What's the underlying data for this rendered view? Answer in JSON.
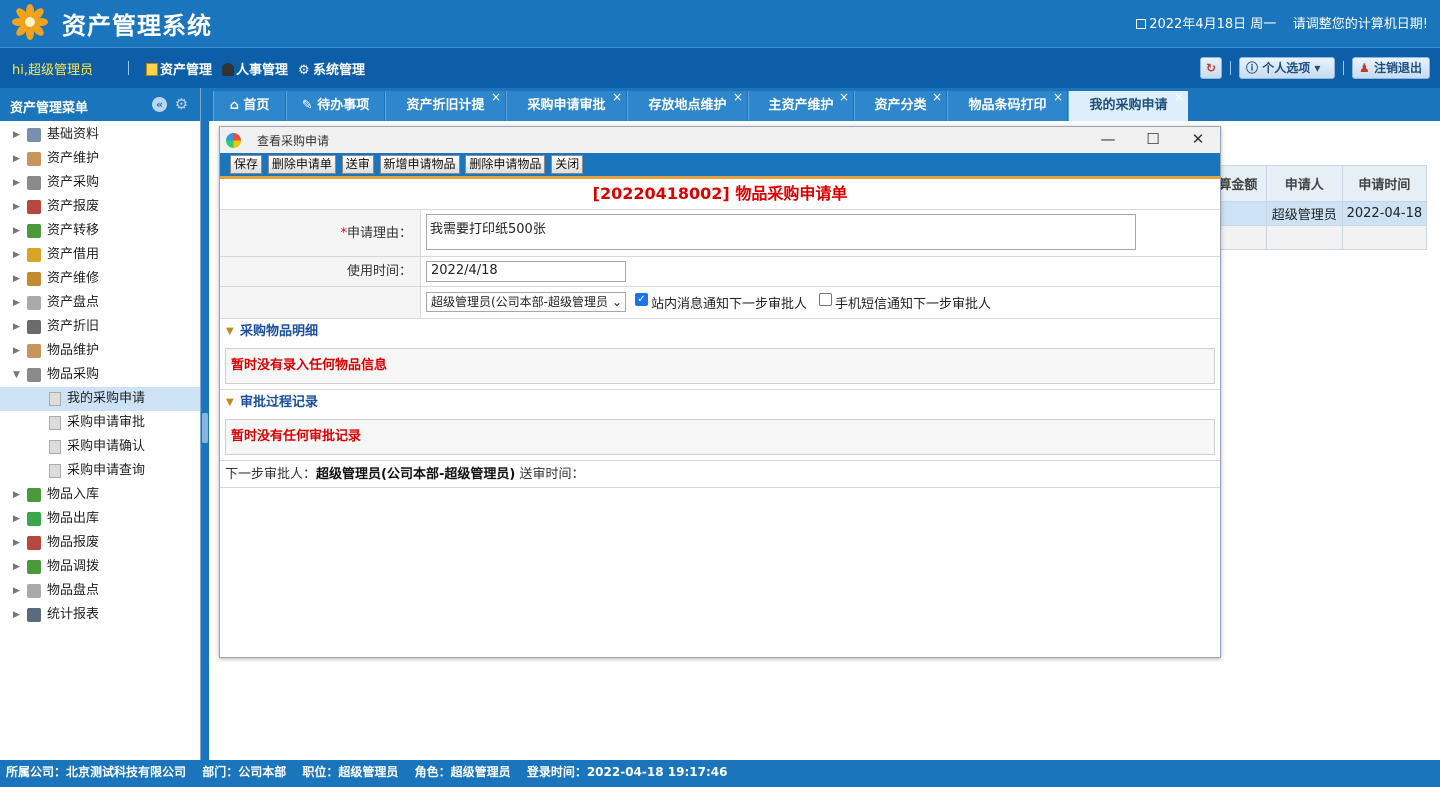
{
  "app": {
    "title": "资产管理系统",
    "date": "2022年4月18日 周一",
    "date_notice": "请调整您的计算机日期!"
  },
  "menubar": {
    "greeting": "hi,超级管理员",
    "menus": [
      "资产管理",
      "人事管理",
      "系统管理"
    ],
    "refresh_icon": "refresh-icon",
    "personal_label": "个人选项",
    "logout_label": "注销退出"
  },
  "sidebar": {
    "title": "资产管理菜单",
    "items": [
      {
        "label": "基础资料",
        "icon": "folder-icon",
        "color": "#7a8fb0"
      },
      {
        "label": "资产维护",
        "icon": "box-icon",
        "color": "#c9955a"
      },
      {
        "label": "资产采购",
        "icon": "cart-icon",
        "color": "#8a8a8a"
      },
      {
        "label": "资产报废",
        "icon": "trash-icon",
        "color": "#b8473f"
      },
      {
        "label": "资产转移",
        "icon": "transfer-icon",
        "color": "#4a9a3c"
      },
      {
        "label": "资产借用",
        "icon": "borrow-icon",
        "color": "#d9a326"
      },
      {
        "label": "资产维修",
        "icon": "repair-icon",
        "color": "#c48a2e"
      },
      {
        "label": "资产盘点",
        "icon": "calendar-icon",
        "color": "#aaaaaa"
      },
      {
        "label": "资产折旧",
        "icon": "calculator-icon",
        "color": "#6b6b6b"
      },
      {
        "label": "物品维护",
        "icon": "box-icon",
        "color": "#c9955a"
      },
      {
        "label": "物品采购",
        "icon": "cart-icon",
        "color": "#8a8a8a"
      }
    ],
    "children": [
      "我的采购申请",
      "采购申请审批",
      "采购申请确认",
      "采购申请查询"
    ],
    "items_after": [
      {
        "label": "物品入库",
        "icon": "inbound-icon",
        "color": "#4a9a3c"
      },
      {
        "label": "物品出库",
        "icon": "outbound-icon",
        "color": "#3aa84a"
      },
      {
        "label": "物品报废",
        "icon": "trash-icon",
        "color": "#b8473f"
      },
      {
        "label": "物品调拨",
        "icon": "transfer-icon",
        "color": "#4a9a3c"
      },
      {
        "label": "物品盘点",
        "icon": "calendar-icon",
        "color": "#aaaaaa"
      },
      {
        "label": "统计报表",
        "icon": "chart-icon",
        "color": "#5a6a80"
      }
    ]
  },
  "tabs": [
    {
      "label": "首页",
      "closable": false
    },
    {
      "label": "待办事项",
      "closable": false
    },
    {
      "label": "资产折旧计提",
      "closable": true
    },
    {
      "label": "采购申请审批",
      "closable": true
    },
    {
      "label": "存放地点维护",
      "closable": true
    },
    {
      "label": "主资产维护",
      "closable": true
    },
    {
      "label": "资产分类",
      "closable": true
    },
    {
      "label": "物品条码打印",
      "closable": true
    },
    {
      "label": "我的采购申请",
      "closable": true,
      "active": true
    }
  ],
  "bg_table": {
    "headers": [
      "算金额",
      "申请人",
      "申请时间"
    ],
    "row": [
      "",
      "超级管理员",
      "2022-04-18"
    ]
  },
  "dialog": {
    "caption": "查看采购申请",
    "toolbar": [
      "保存",
      "删除申请单",
      "送审",
      "新增申请物品",
      "删除申请物品",
      "关闭"
    ],
    "form_title": "[20220418002] 物品采购申请单",
    "reason_label": "申请理由：",
    "reason_required": "*",
    "reason_value": "我需要打印纸500张",
    "date_label": "使用时间：",
    "date_value": "2022/4/18",
    "approver_selected": "超级管理员(公司本部-超级管理员)",
    "notify_site": "站内消息通知下一步审批人",
    "notify_sms": "手机短信通知下一步审批人",
    "section_items": "采购物品明细",
    "items_empty": "暂时没有录入任何物品信息",
    "section_log": "审批过程记录",
    "log_empty": "暂时没有任何审批记录",
    "next_approver_label": "下一步审批人：",
    "next_approver_value": "超级管理员(公司本部-超级管理员)",
    "send_time_label": "送审时间："
  },
  "footer": {
    "company": "所属公司：北京测试科技有限公司",
    "dept": "部门：公司本部",
    "position": "职位：超级管理员",
    "role": "角色：超级管理员",
    "login": "登录时间：2022-04-18 19:17:46"
  },
  "colors": {
    "primary": "#1a75bc",
    "accent_red": "#d00000",
    "greeting": "#ffe74a"
  }
}
